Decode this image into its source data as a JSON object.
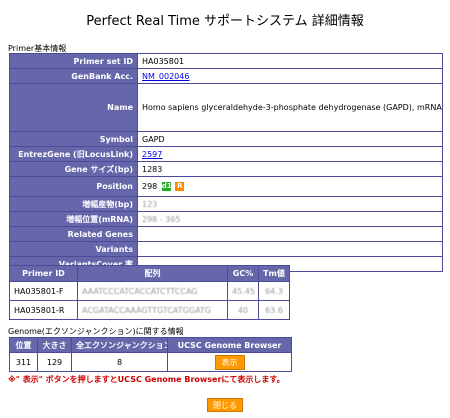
{
  "page": {
    "title": "Perfect Real Time サポートシステム 詳細情報"
  },
  "primer_basic": {
    "section_label": "Primer基本情報",
    "rows": [
      {
        "label": "Primer set ID",
        "value": "HA035801"
      },
      {
        "label": "GenBank Acc.",
        "value": "NM_002046"
      },
      {
        "label": "Name",
        "value": "Homo sapiens glyceraldehyde-3-phosphate dehydrogenase (GAPD), mRNA."
      },
      {
        "label": "Symbol",
        "value": "GAPD"
      },
      {
        "label": "EntrezGene (旧LocusLink)",
        "value": "2597"
      },
      {
        "label": "Gene サイズ(bp)",
        "value": "1283"
      },
      {
        "label": "Position",
        "value": "298",
        "badge_d": "d1",
        "badge_r": "R"
      },
      {
        "label": "増幅産物(bp)",
        "value": "123"
      },
      {
        "label": "増幅位置(mRNA)",
        "value": "298 - 365"
      },
      {
        "label": "Related Genes",
        "value": ""
      },
      {
        "label": "Variants",
        "value": ""
      },
      {
        "label": "VariantsCover 率",
        "value": ""
      }
    ]
  },
  "primer_seq": {
    "headers": [
      "Primer ID",
      "配列",
      "GC%",
      "Tm値"
    ],
    "rows": [
      {
        "id": "HA035801-F",
        "seq": "AAATCCCATCACCATCTTCCAG",
        "gc": "45.45",
        "tm": "64.3"
      },
      {
        "id": "HA035801-R",
        "seq": "ACGATACCAAAGTTGTCATGGATG",
        "gc": "40",
        "tm": "63.6"
      }
    ]
  },
  "genome": {
    "section_label": "Genome(エクソンジャンクション)に関する情報",
    "headers": [
      "位置",
      "大きさ",
      "全エクソンジャンクション",
      "UCSC Genome Browser"
    ],
    "row": {
      "position": "311",
      "size": "129",
      "junction": "8",
      "button": "表示"
    }
  },
  "note": "※\" 表示\" ボタンを押しますとUCSC Genome Browserにて表示します。",
  "close_button": "閉じる",
  "colors": {
    "header_bg": "#6666aa",
    "border": "#4b4b9a",
    "button": "#ff9900",
    "note": "#cc0000"
  }
}
